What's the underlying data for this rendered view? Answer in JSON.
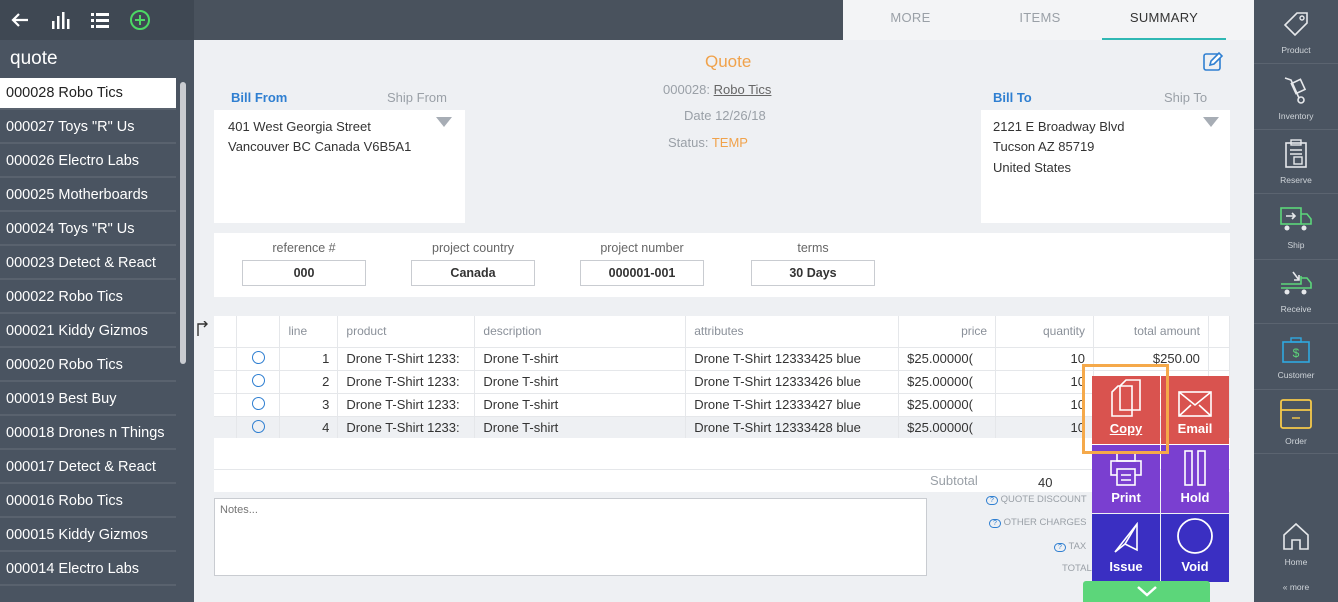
{
  "toolbar": {
    "icons": [
      "back-arrow-icon",
      "bar-chart-icon",
      "list-icon",
      "add-circle-icon"
    ]
  },
  "sidebar": {
    "title": "quote",
    "items": [
      {
        "label": "000028 Robo Tics",
        "active": true
      },
      {
        "label": "000027 Toys \"R\" Us"
      },
      {
        "label": "000026 Electro Labs"
      },
      {
        "label": "000025 Motherboards"
      },
      {
        "label": "000024 Toys \"R\" Us"
      },
      {
        "label": "000023 Detect & React"
      },
      {
        "label": "000022 Robo Tics"
      },
      {
        "label": "000021 Kiddy Gizmos"
      },
      {
        "label": "000020 Robo Tics"
      },
      {
        "label": "000019 Best Buy"
      },
      {
        "label": "000018 Drones n Things"
      },
      {
        "label": "000017 Detect & React"
      },
      {
        "label": "000016 Robo Tics"
      },
      {
        "label": "000015 Kiddy Gizmos"
      },
      {
        "label": "000014 Electro Labs"
      }
    ]
  },
  "tabs": [
    {
      "label": "MORE"
    },
    {
      "label": "ITEMS"
    },
    {
      "label": "SUMMARY",
      "active": true
    }
  ],
  "header": {
    "title": "Quote",
    "quote_no": "000028:",
    "customer": "Robo Tics",
    "date": "Date 12/26/18",
    "status_label": "Status:",
    "status_value": "TEMP"
  },
  "bill_from": {
    "tab": "Bill From",
    "alt_tab": "Ship From",
    "line1": "401 West Georgia Street",
    "line2": "Vancouver BC Canada V6B5A1"
  },
  "bill_to": {
    "tab": "Bill To",
    "alt_tab": "Ship To",
    "line1": "2121 E Broadway Blvd",
    "line2": "Tucson AZ 85719",
    "line3": "United States"
  },
  "fields": [
    {
      "label": "reference #",
      "value": "000"
    },
    {
      "label": "project country",
      "value": "Canada"
    },
    {
      "label": "project number",
      "value": "000001-001"
    },
    {
      "label": "terms",
      "value": "30 Days"
    }
  ],
  "table": {
    "headers": [
      "line",
      "product",
      "description",
      "attributes",
      "price",
      "quantity",
      "total amount"
    ],
    "rows": [
      {
        "line": "1",
        "product": "Drone T-Shirt 1233:",
        "description": "Drone T-shirt",
        "attributes": "Drone T-Shirt 12333425 blue",
        "price": "$25.00000(",
        "quantity": "10",
        "total": "$250.00"
      },
      {
        "line": "2",
        "product": "Drone T-Shirt 1233:",
        "description": "Drone T-shirt",
        "attributes": "Drone T-Shirt 12333426 blue",
        "price": "$25.00000(",
        "quantity": "10",
        "total": ""
      },
      {
        "line": "3",
        "product": "Drone T-Shirt 1233:",
        "description": "Drone T-shirt",
        "attributes": "Drone T-Shirt 12333427 blue",
        "price": "$25.00000(",
        "quantity": "10",
        "total": ""
      },
      {
        "line": "4",
        "product": "Drone T-Shirt 1233:",
        "description": "Drone T-shirt",
        "attributes": "Drone T-Shirt 12333428 blue",
        "price": "$25.00000(",
        "quantity": "10",
        "total": ""
      }
    ],
    "subtotal_label": "Subtotal",
    "subtotal_qty": "40"
  },
  "notes": {
    "placeholder": "Notes..."
  },
  "totals": {
    "quote_discount": "QUOTE DISCOUNT",
    "other_charges": "OTHER CHARGES",
    "tax": "TAX",
    "total": "TOTAL"
  },
  "actions": [
    {
      "label": "Copy",
      "color": "#d9534f"
    },
    {
      "label": "Email",
      "color": "#d9534f"
    },
    {
      "label": "Print",
      "color": "#7a3fd0"
    },
    {
      "label": "Hold",
      "color": "#7a3fd0"
    },
    {
      "label": "Issue",
      "color": "#3a2fc2"
    },
    {
      "label": "Void",
      "color": "#3a2fc2"
    }
  ],
  "rightbar": [
    {
      "label": "Product",
      "icon": "tag-icon"
    },
    {
      "label": "Inventory",
      "icon": "hand-truck-icon"
    },
    {
      "label": "Reserve",
      "icon": "clipboard-icon"
    },
    {
      "label": "Ship",
      "icon": "truck-out-icon"
    },
    {
      "label": "Receive",
      "icon": "truck-in-icon"
    },
    {
      "label": "Customer",
      "icon": "dollar-briefcase-icon"
    },
    {
      "label": "Order",
      "icon": "box-icon"
    },
    {
      "label": "Home",
      "icon": "home-icon"
    },
    {
      "label": "« more",
      "icon": ""
    }
  ],
  "colors": {
    "accent_blue": "#2f7fd1",
    "orange": "#f0a24b",
    "teal": "#30b8b4",
    "sidebar": "#4a5461",
    "green": "#5cd67a"
  }
}
